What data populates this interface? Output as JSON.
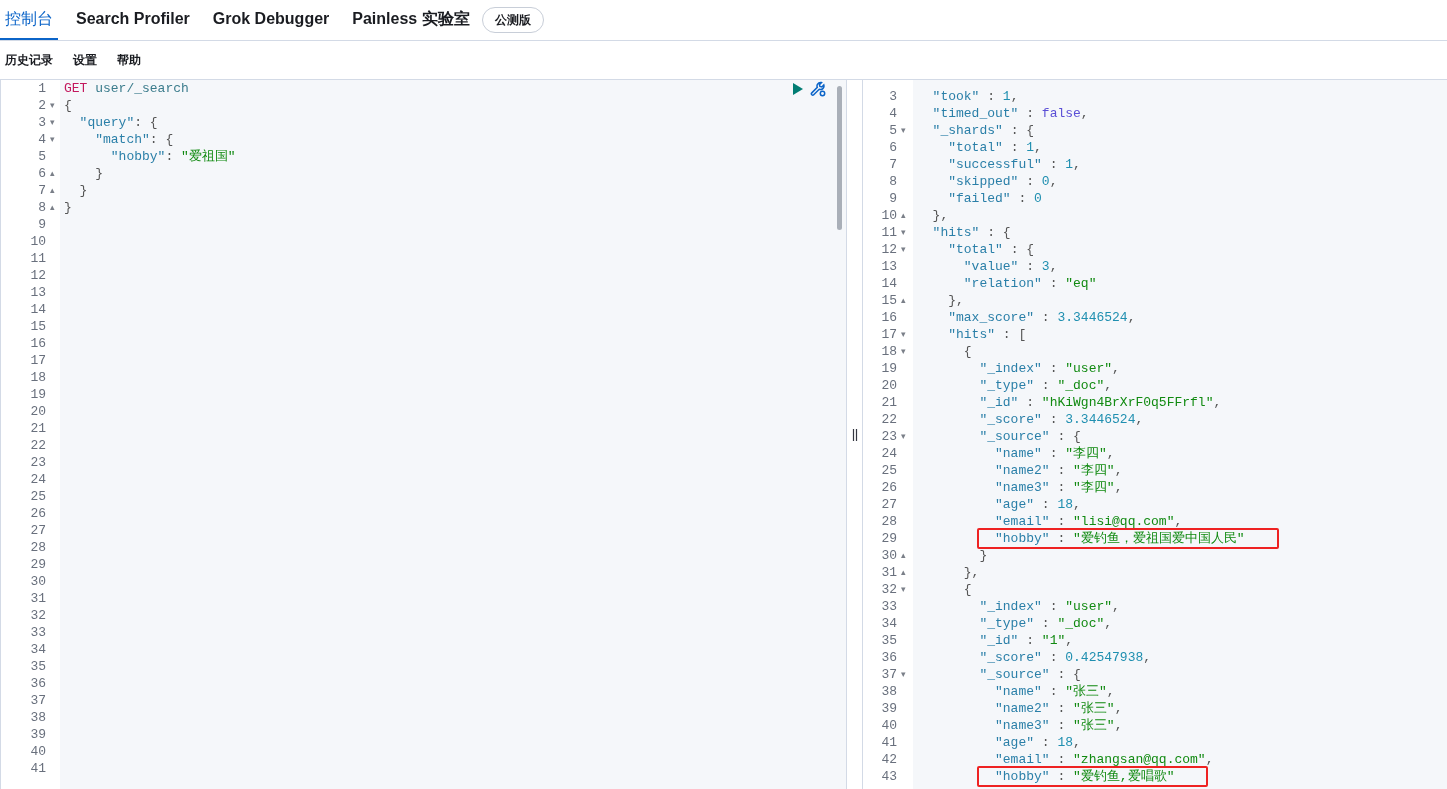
{
  "tabs": [
    {
      "label": "控制台",
      "selected": true
    },
    {
      "label": "Search Profiler",
      "selected": false
    },
    {
      "label": "Grok Debugger",
      "selected": false
    },
    {
      "label": "Painless 实验室",
      "selected": false,
      "badge": "公测版"
    }
  ],
  "menu": [
    "历史记录",
    "设置",
    "帮助"
  ],
  "request": {
    "lines": [
      {
        "number": "1",
        "segments": [
          {
            "kind": "method",
            "text": "GET"
          },
          {
            "kind": "url",
            "text": " user/_search"
          }
        ]
      },
      {
        "number": "2",
        "fold": "▾",
        "segments": [
          {
            "kind": "punct",
            "text": "{"
          }
        ]
      },
      {
        "number": "3",
        "fold": "▾",
        "segments": [
          {
            "kind": "key",
            "text": "  \"query\""
          },
          {
            "kind": "punct",
            "text": ": {"
          }
        ]
      },
      {
        "number": "4",
        "fold": "▾",
        "segments": [
          {
            "kind": "key",
            "text": "    \"match\""
          },
          {
            "kind": "punct",
            "text": ": {"
          }
        ]
      },
      {
        "number": "5",
        "segments": [
          {
            "kind": "key",
            "text": "      \"hobby\""
          },
          {
            "kind": "punct",
            "text": ": "
          },
          {
            "kind": "string",
            "text": "\"爱祖国\""
          }
        ]
      },
      {
        "number": "6",
        "fold": "▴",
        "segments": [
          {
            "kind": "punct",
            "text": "    }"
          }
        ]
      },
      {
        "number": "7",
        "fold": "▴",
        "segments": [
          {
            "kind": "punct",
            "text": "  }"
          }
        ]
      },
      {
        "number": "8",
        "fold": "▴",
        "segments": [
          {
            "kind": "punct",
            "text": "}"
          }
        ]
      },
      {
        "number": "9"
      },
      {
        "number": "10"
      },
      {
        "number": "11"
      },
      {
        "number": "12"
      },
      {
        "number": "13"
      },
      {
        "number": "14"
      },
      {
        "number": "15"
      },
      {
        "number": "16"
      },
      {
        "number": "17"
      },
      {
        "number": "18"
      },
      {
        "number": "19"
      },
      {
        "number": "20"
      },
      {
        "number": "21"
      },
      {
        "number": "22"
      },
      {
        "number": "23"
      },
      {
        "number": "24"
      },
      {
        "number": "25"
      },
      {
        "number": "26"
      },
      {
        "number": "27"
      },
      {
        "number": "28"
      },
      {
        "number": "29"
      },
      {
        "number": "30"
      },
      {
        "number": "31"
      },
      {
        "number": "32"
      },
      {
        "number": "33"
      },
      {
        "number": "34"
      },
      {
        "number": "35"
      },
      {
        "number": "36"
      },
      {
        "number": "37"
      },
      {
        "number": "38"
      },
      {
        "number": "39"
      },
      {
        "number": "40"
      },
      {
        "number": "41"
      }
    ]
  },
  "response": {
    "lines": [
      {
        "number": "3",
        "segments": [
          {
            "kind": "key",
            "text": "  \"took\""
          },
          {
            "kind": "punct",
            "text": " : "
          },
          {
            "kind": "number",
            "text": "1"
          },
          {
            "kind": "punct",
            "text": ","
          }
        ]
      },
      {
        "number": "4",
        "segments": [
          {
            "kind": "key",
            "text": "  \"timed_out\""
          },
          {
            "kind": "punct",
            "text": " : "
          },
          {
            "kind": "boolean",
            "text": "false"
          },
          {
            "kind": "punct",
            "text": ","
          }
        ]
      },
      {
        "number": "5",
        "fold": "▾",
        "segments": [
          {
            "kind": "key",
            "text": "  \"_shards\""
          },
          {
            "kind": "punct",
            "text": " : {"
          }
        ]
      },
      {
        "number": "6",
        "segments": [
          {
            "kind": "key",
            "text": "    \"total\""
          },
          {
            "kind": "punct",
            "text": " : "
          },
          {
            "kind": "number",
            "text": "1"
          },
          {
            "kind": "punct",
            "text": ","
          }
        ]
      },
      {
        "number": "7",
        "segments": [
          {
            "kind": "key",
            "text": "    \"successful\""
          },
          {
            "kind": "punct",
            "text": " : "
          },
          {
            "kind": "number",
            "text": "1"
          },
          {
            "kind": "punct",
            "text": ","
          }
        ]
      },
      {
        "number": "8",
        "segments": [
          {
            "kind": "key",
            "text": "    \"skipped\""
          },
          {
            "kind": "punct",
            "text": " : "
          },
          {
            "kind": "number",
            "text": "0"
          },
          {
            "kind": "punct",
            "text": ","
          }
        ]
      },
      {
        "number": "9",
        "segments": [
          {
            "kind": "key",
            "text": "    \"failed\""
          },
          {
            "kind": "punct",
            "text": " : "
          },
          {
            "kind": "number",
            "text": "0"
          }
        ]
      },
      {
        "number": "10",
        "fold": "▴",
        "segments": [
          {
            "kind": "punct",
            "text": "  },"
          }
        ]
      },
      {
        "number": "11",
        "fold": "▾",
        "segments": [
          {
            "kind": "key",
            "text": "  \"hits\""
          },
          {
            "kind": "punct",
            "text": " : {"
          }
        ]
      },
      {
        "number": "12",
        "fold": "▾",
        "segments": [
          {
            "kind": "key",
            "text": "    \"total\""
          },
          {
            "kind": "punct",
            "text": " : {"
          }
        ]
      },
      {
        "number": "13",
        "segments": [
          {
            "kind": "key",
            "text": "      \"value\""
          },
          {
            "kind": "punct",
            "text": " : "
          },
          {
            "kind": "number",
            "text": "3"
          },
          {
            "kind": "punct",
            "text": ","
          }
        ]
      },
      {
        "number": "14",
        "segments": [
          {
            "kind": "key",
            "text": "      \"relation\""
          },
          {
            "kind": "punct",
            "text": " : "
          },
          {
            "kind": "string",
            "text": "\"eq\""
          }
        ]
      },
      {
        "number": "15",
        "fold": "▴",
        "segments": [
          {
            "kind": "punct",
            "text": "    },"
          }
        ]
      },
      {
        "number": "16",
        "segments": [
          {
            "kind": "key",
            "text": "    \"max_score\""
          },
          {
            "kind": "punct",
            "text": " : "
          },
          {
            "kind": "number",
            "text": "3.3446524"
          },
          {
            "kind": "punct",
            "text": ","
          }
        ]
      },
      {
        "number": "17",
        "fold": "▾",
        "segments": [
          {
            "kind": "key",
            "text": "    \"hits\""
          },
          {
            "kind": "punct",
            "text": " : ["
          }
        ]
      },
      {
        "number": "18",
        "fold": "▾",
        "segments": [
          {
            "kind": "punct",
            "text": "      {"
          }
        ]
      },
      {
        "number": "19",
        "segments": [
          {
            "kind": "key",
            "text": "        \"_index\""
          },
          {
            "kind": "punct",
            "text": " : "
          },
          {
            "kind": "string",
            "text": "\"user\""
          },
          {
            "kind": "punct",
            "text": ","
          }
        ]
      },
      {
        "number": "20",
        "segments": [
          {
            "kind": "key",
            "text": "        \"_type\""
          },
          {
            "kind": "punct",
            "text": " : "
          },
          {
            "kind": "string",
            "text": "\"_doc\""
          },
          {
            "kind": "punct",
            "text": ","
          }
        ]
      },
      {
        "number": "21",
        "segments": [
          {
            "kind": "key",
            "text": "        \"_id\""
          },
          {
            "kind": "punct",
            "text": " : "
          },
          {
            "kind": "string",
            "text": "\"hKiWgn4BrXrF0q5FFrfl\""
          },
          {
            "kind": "punct",
            "text": ","
          }
        ]
      },
      {
        "number": "22",
        "segments": [
          {
            "kind": "key",
            "text": "        \"_score\""
          },
          {
            "kind": "punct",
            "text": " : "
          },
          {
            "kind": "number",
            "text": "3.3446524"
          },
          {
            "kind": "punct",
            "text": ","
          }
        ]
      },
      {
        "number": "23",
        "fold": "▾",
        "segments": [
          {
            "kind": "key",
            "text": "        \"_source\""
          },
          {
            "kind": "punct",
            "text": " : {"
          }
        ]
      },
      {
        "number": "24",
        "segments": [
          {
            "kind": "key",
            "text": "          \"name\""
          },
          {
            "kind": "punct",
            "text": " : "
          },
          {
            "kind": "string",
            "text": "\"李四\""
          },
          {
            "kind": "punct",
            "text": ","
          }
        ]
      },
      {
        "number": "25",
        "segments": [
          {
            "kind": "key",
            "text": "          \"name2\""
          },
          {
            "kind": "punct",
            "text": " : "
          },
          {
            "kind": "string",
            "text": "\"李四\""
          },
          {
            "kind": "punct",
            "text": ","
          }
        ]
      },
      {
        "number": "26",
        "segments": [
          {
            "kind": "key",
            "text": "          \"name3\""
          },
          {
            "kind": "punct",
            "text": " : "
          },
          {
            "kind": "string",
            "text": "\"李四\""
          },
          {
            "kind": "punct",
            "text": ","
          }
        ]
      },
      {
        "number": "27",
        "segments": [
          {
            "kind": "key",
            "text": "          \"age\""
          },
          {
            "kind": "punct",
            "text": " : "
          },
          {
            "kind": "number",
            "text": "18"
          },
          {
            "kind": "punct",
            "text": ","
          }
        ]
      },
      {
        "number": "28",
        "segments": [
          {
            "kind": "key",
            "text": "          \"email\""
          },
          {
            "kind": "punct",
            "text": " : "
          },
          {
            "kind": "string",
            "text": "\"lisi@qq.com\""
          },
          {
            "kind": "punct",
            "text": ","
          }
        ]
      },
      {
        "number": "29",
        "boxed": true,
        "segments": [
          {
            "kind": "key",
            "text": "          \"hobby\""
          },
          {
            "kind": "punct",
            "text": " : "
          },
          {
            "kind": "string",
            "text": "\"爱钓鱼，爱祖国爱中国人民\""
          }
        ]
      },
      {
        "number": "30",
        "fold": "▴",
        "segments": [
          {
            "kind": "punct",
            "text": "        }"
          }
        ]
      },
      {
        "number": "31",
        "fold": "▴",
        "segments": [
          {
            "kind": "punct",
            "text": "      },"
          }
        ]
      },
      {
        "number": "32",
        "fold": "▾",
        "segments": [
          {
            "kind": "punct",
            "text": "      {"
          }
        ]
      },
      {
        "number": "33",
        "segments": [
          {
            "kind": "key",
            "text": "        \"_index\""
          },
          {
            "kind": "punct",
            "text": " : "
          },
          {
            "kind": "string",
            "text": "\"user\""
          },
          {
            "kind": "punct",
            "text": ","
          }
        ]
      },
      {
        "number": "34",
        "segments": [
          {
            "kind": "key",
            "text": "        \"_type\""
          },
          {
            "kind": "punct",
            "text": " : "
          },
          {
            "kind": "string",
            "text": "\"_doc\""
          },
          {
            "kind": "punct",
            "text": ","
          }
        ]
      },
      {
        "number": "35",
        "segments": [
          {
            "kind": "key",
            "text": "        \"_id\""
          },
          {
            "kind": "punct",
            "text": " : "
          },
          {
            "kind": "string",
            "text": "\"1\""
          },
          {
            "kind": "punct",
            "text": ","
          }
        ]
      },
      {
        "number": "36",
        "segments": [
          {
            "kind": "key",
            "text": "        \"_score\""
          },
          {
            "kind": "punct",
            "text": " : "
          },
          {
            "kind": "number",
            "text": "0.42547938"
          },
          {
            "kind": "punct",
            "text": ","
          }
        ]
      },
      {
        "number": "37",
        "fold": "▾",
        "segments": [
          {
            "kind": "key",
            "text": "        \"_source\""
          },
          {
            "kind": "punct",
            "text": " : {"
          }
        ]
      },
      {
        "number": "38",
        "segments": [
          {
            "kind": "key",
            "text": "          \"name\""
          },
          {
            "kind": "punct",
            "text": " : "
          },
          {
            "kind": "string",
            "text": "\"张三\""
          },
          {
            "kind": "punct",
            "text": ","
          }
        ]
      },
      {
        "number": "39",
        "segments": [
          {
            "kind": "key",
            "text": "          \"name2\""
          },
          {
            "kind": "punct",
            "text": " : "
          },
          {
            "kind": "string",
            "text": "\"张三\""
          },
          {
            "kind": "punct",
            "text": ","
          }
        ]
      },
      {
        "number": "40",
        "segments": [
          {
            "kind": "key",
            "text": "          \"name3\""
          },
          {
            "kind": "punct",
            "text": " : "
          },
          {
            "kind": "string",
            "text": "\"张三\""
          },
          {
            "kind": "punct",
            "text": ","
          }
        ]
      },
      {
        "number": "41",
        "segments": [
          {
            "kind": "key",
            "text": "          \"age\""
          },
          {
            "kind": "punct",
            "text": " : "
          },
          {
            "kind": "number",
            "text": "18"
          },
          {
            "kind": "punct",
            "text": ","
          }
        ]
      },
      {
        "number": "42",
        "segments": [
          {
            "kind": "key",
            "text": "          \"email\""
          },
          {
            "kind": "punct",
            "text": " : "
          },
          {
            "kind": "string",
            "text": "\"zhangsan@qq.com\""
          },
          {
            "kind": "punct",
            "text": ","
          }
        ]
      },
      {
        "number": "43",
        "boxed": true,
        "segments": [
          {
            "kind": "key",
            "text": "          \"hobby\""
          },
          {
            "kind": "punct",
            "text": " : "
          },
          {
            "kind": "string",
            "text": "\"爱钓鱼,爱唱歌\""
          }
        ]
      }
    ]
  }
}
